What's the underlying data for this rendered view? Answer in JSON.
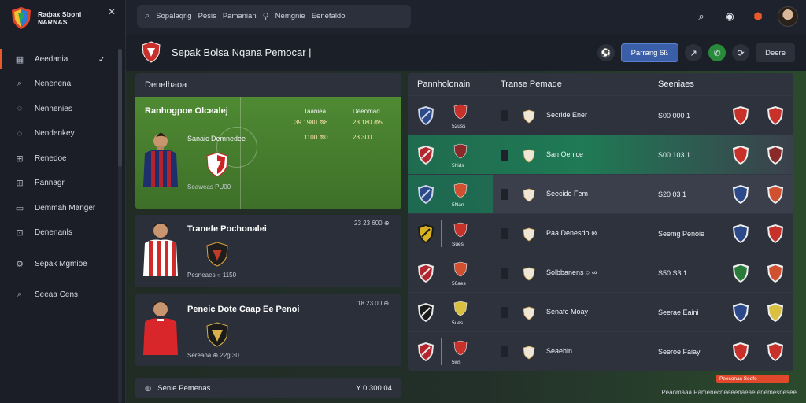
{
  "brand": {
    "line1": "Raфак Sboni",
    "line2": "NARNAS"
  },
  "sidebar": {
    "items": [
      {
        "label": "Aeedania",
        "icon": "calendar-icon",
        "active": true,
        "checked": true
      },
      {
        "label": "Nenenena",
        "icon": "search-icon"
      },
      {
        "label": "Nennenies",
        "icon": "chat-icon"
      },
      {
        "label": "Nendenkey",
        "icon": "chat-icon"
      },
      {
        "label": "Renedoe",
        "icon": "grid-icon"
      },
      {
        "label": "Pannagr",
        "icon": "grid-icon"
      },
      {
        "label": "Demmah Manger",
        "icon": "folder-icon"
      },
      {
        "label": "Denenanls",
        "icon": "bookmark-icon"
      },
      {
        "label": "Sepak Mgmioe",
        "icon": "settings-icon"
      },
      {
        "label": "Seeaa Cens",
        "icon": "search-icon"
      }
    ]
  },
  "topbar": {
    "search_tokens": [
      "Sopalaqrig",
      "Pesis",
      "Pamanian",
      "Nemgnie",
      "Eenefaldo"
    ]
  },
  "page": {
    "title": "Sepak Bolsa Nqana Pemocar |",
    "primary_button": "Parrang 6ß",
    "ghost_button": "Deere"
  },
  "left_panel": {
    "header": "Denelhaoa",
    "feature": {
      "title": "Ranhogpoe Olcealej",
      "player_name": "Sanaic Demnedee",
      "meta": "Seaweas PU00",
      "col1_label": "Taaniea",
      "col2_label": "Deeomad",
      "row1": [
        "39 1980 ⊚8",
        "23 180 ⊚5"
      ],
      "row2": [
        "1100 ⊚0",
        "23 300"
      ]
    },
    "cards": [
      {
        "title": "Tranefe Pochonalei",
        "meta": "Pesneaes ○ 1150",
        "right": "23 23 600 ⊕"
      },
      {
        "title": "Peneic Dote Caap Ee Penoi",
        "meta": "Sereaoa ⊕ 22g 30",
        "right": "18 23 00 ⊕"
      }
    ],
    "bottom_bar": {
      "label": "Senie Pemenas",
      "value": "Y 0 300 04"
    }
  },
  "table": {
    "headers": [
      "Pannholonain",
      "Transe Pemade",
      "Seeniaes"
    ],
    "rows": [
      {
        "club_code": "52uss",
        "player": "Secride Ener",
        "value": "S00 000 1",
        "style": "dark"
      },
      {
        "club_code": "5hids",
        "player": "San Oenice",
        "value": "S00 103 1",
        "style": "hl"
      },
      {
        "club_code": "5Nan",
        "player": "Seecide Fem",
        "value": "S20 03 1",
        "style": "hl2"
      },
      {
        "club_code": "Sues",
        "player": "Paa Denesdo ⊛",
        "value": "Seemg Penoie",
        "style": "dark"
      },
      {
        "club_code": "56aes",
        "player": "Solbbanens ○ ∞",
        "value": "S50 S3 1",
        "style": "dark"
      },
      {
        "club_code": "5ues",
        "player": "Senafe Moay",
        "value": "Seerae Eaini",
        "style": "dark"
      },
      {
        "club_code": "5ws",
        "player": "Seaehin",
        "value": "Seeroe Faiay",
        "style": "dark"
      }
    ]
  },
  "footer": {
    "pill": "Peesonac Soofe",
    "note": "Peaomaaa Pamenecneeeenaeae enemesnesee"
  },
  "colors": {
    "accent": "#e8592b",
    "primary": "#3a5fa8",
    "pitch": "#4f8a33",
    "highlight": "#1f7a55"
  }
}
